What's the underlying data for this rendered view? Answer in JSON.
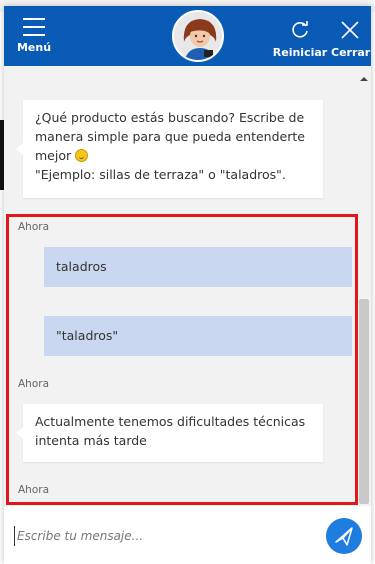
{
  "header": {
    "menu_label": "Menú",
    "restart_label": "Reiniciar",
    "close_label": "Cerrar",
    "background_color": "#0a5bb5"
  },
  "messages": {
    "bot_prompt_line1": "¿Qué producto estás buscando? Escribe de",
    "bot_prompt_line2": "manera simple para que pueda entenderte",
    "bot_prompt_line3": "mejor",
    "bot_prompt_line4": "\"Ejemplo: sillas de terraza\" o \"taladros\".",
    "timestamp_1": "Ahora",
    "user_msg_1": "taladros",
    "user_msg_2": "\"taladros\"",
    "timestamp_2": "Ahora",
    "bot_error_line1": "Actualmente tenemos dificultades técnicas",
    "bot_error_line2": "intenta más tarde",
    "timestamp_3": "Ahora"
  },
  "composer": {
    "placeholder": "Escribe tu mensaje..."
  },
  "icons": {
    "menu": "hamburger-icon",
    "restart": "refresh-icon",
    "close": "close-icon",
    "send": "paper-plane-icon",
    "emoji": "smiley-emoji"
  },
  "colors": {
    "user_bubble": "#c9d7f1",
    "highlight": "#e0181e",
    "send_button": "#1f7de0"
  }
}
